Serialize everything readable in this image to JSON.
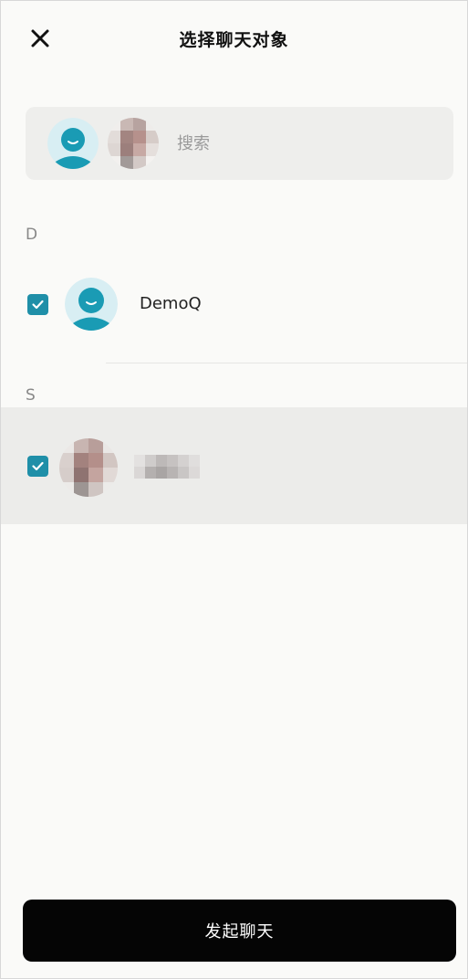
{
  "header": {
    "title": "选择聊天对象",
    "close_icon": "close-icon"
  },
  "search": {
    "placeholder": "搜索",
    "value": ""
  },
  "selected_avatars": [
    {
      "icon": "default-avatar-icon"
    },
    {
      "icon": "pixelated-photo-avatar"
    }
  ],
  "sections": [
    {
      "letter": "D",
      "contacts": [
        {
          "name": "DemoQ",
          "checked": true,
          "avatar": "default-avatar-icon"
        }
      ]
    },
    {
      "letter": "S",
      "contacts": [
        {
          "name": "",
          "checked": true,
          "avatar": "pixelated-photo-avatar",
          "name_obscured": true
        }
      ]
    }
  ],
  "footer": {
    "start_label": "发起聊天"
  },
  "colors": {
    "accent": "#1f8fa8",
    "avatar_bg": "#d8eef3",
    "avatar_fg": "#1a9bb4",
    "button_bg": "#050505",
    "selected_row_bg": "#ececea"
  }
}
